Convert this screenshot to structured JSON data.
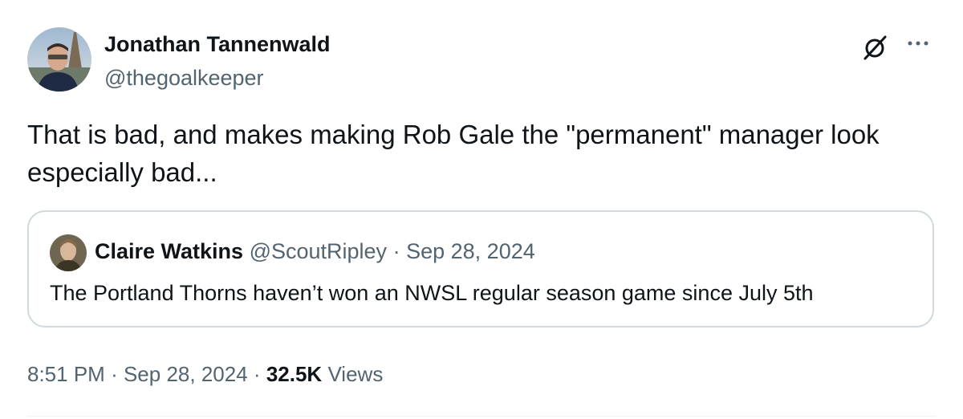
{
  "author": {
    "display_name": "Jonathan Tannenwald",
    "handle": "@thegoalkeeper",
    "avatar_icon": "profile-photo-eiffel-tower"
  },
  "actions": {
    "grok_icon": "grok-icon",
    "more_icon": "more-dots-icon"
  },
  "tweet": {
    "text": "That is bad, and makes making Rob Gale the \"permanent\" manager look especially bad..."
  },
  "quote": {
    "display_name": "Claire Watkins",
    "handle": "@ScoutRipley",
    "separator": "·",
    "date": "Sep 28, 2024",
    "text": "The Portland Thorns haven’t won an NWSL regular season game since July 5th",
    "avatar_icon": "profile-photo"
  },
  "meta": {
    "time": "8:51 PM",
    "separator": "·",
    "date": "Sep 28, 2024",
    "views_count": "32.5K",
    "views_label": "Views"
  },
  "colors": {
    "text_primary": "#0f1419",
    "text_secondary": "#536471",
    "border": "#cfd9de",
    "divider": "#eff3f4"
  }
}
